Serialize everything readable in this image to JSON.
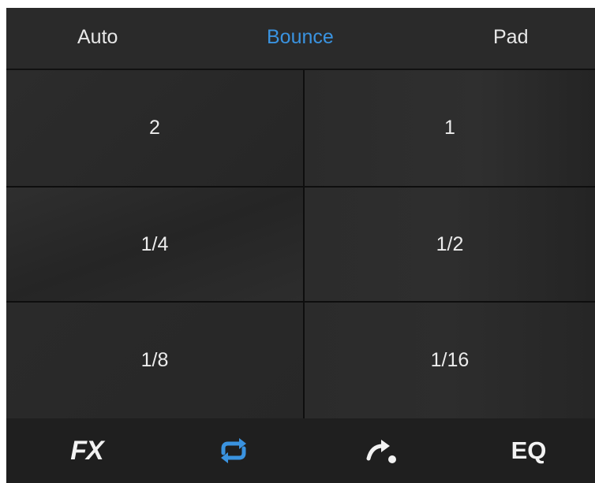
{
  "tabs": {
    "auto": "Auto",
    "bounce": "Bounce",
    "pad": "Pad",
    "active": "Bounce"
  },
  "grid": {
    "cells": [
      "2",
      "1",
      "1/4",
      "1/2",
      "1/8",
      "1/16"
    ]
  },
  "toolbar": {
    "fx_label": "FX",
    "loop_icon": "loop-icon",
    "slip_icon": "slip-icon",
    "eq_label": "EQ",
    "active": "loop"
  },
  "colors": {
    "accent": "#3a93e0",
    "background": "#232323",
    "text": "#e8e8e8"
  }
}
